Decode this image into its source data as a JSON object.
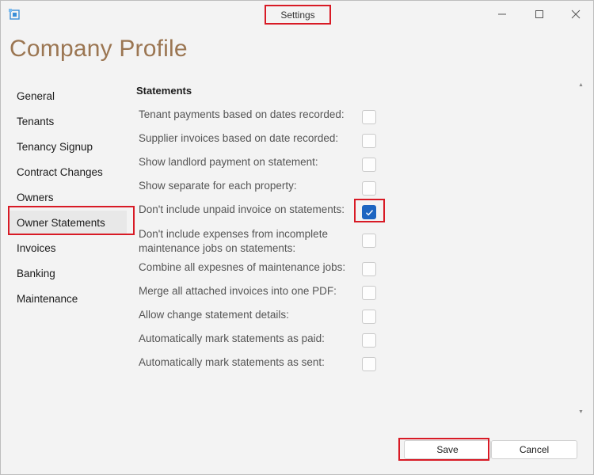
{
  "window": {
    "title": "Settings"
  },
  "page": {
    "title": "Company Profile"
  },
  "sidebar": {
    "items": [
      {
        "label": "General"
      },
      {
        "label": "Tenants"
      },
      {
        "label": "Tenancy Signup"
      },
      {
        "label": "Contract Changes"
      },
      {
        "label": "Owners"
      },
      {
        "label": "Owner Statements",
        "selected": true
      },
      {
        "label": "Invoices"
      },
      {
        "label": "Banking"
      },
      {
        "label": "Maintenance"
      }
    ]
  },
  "statements": {
    "section_title": "Statements",
    "settings": [
      {
        "label": "Tenant payments based on dates recorded:",
        "checked": false
      },
      {
        "label": "Supplier invoices based on date recorded:",
        "checked": false
      },
      {
        "label": "Show landlord payment on statement:",
        "checked": false
      },
      {
        "label": "Show separate for each property:",
        "checked": false
      },
      {
        "label": "Don't include unpaid invoice on statements:",
        "checked": true
      },
      {
        "label": "Don't include expenses from incomplete maintenance jobs on statements:",
        "checked": false
      },
      {
        "label": "Combine all expesnes of maintenance jobs:",
        "checked": false
      },
      {
        "label": "Merge all attached invoices into one PDF:",
        "checked": false
      },
      {
        "label": "Allow change statement details:",
        "checked": false
      },
      {
        "label": "Automatically mark statements as paid:",
        "checked": false
      },
      {
        "label": "Automatically mark statements as sent:",
        "checked": false
      }
    ]
  },
  "buttons": {
    "save_label": "Save",
    "cancel_label": "Cancel"
  },
  "colors": {
    "accent": "#1d65c1",
    "highlight": "#d81a25",
    "title": "#9b7652"
  }
}
